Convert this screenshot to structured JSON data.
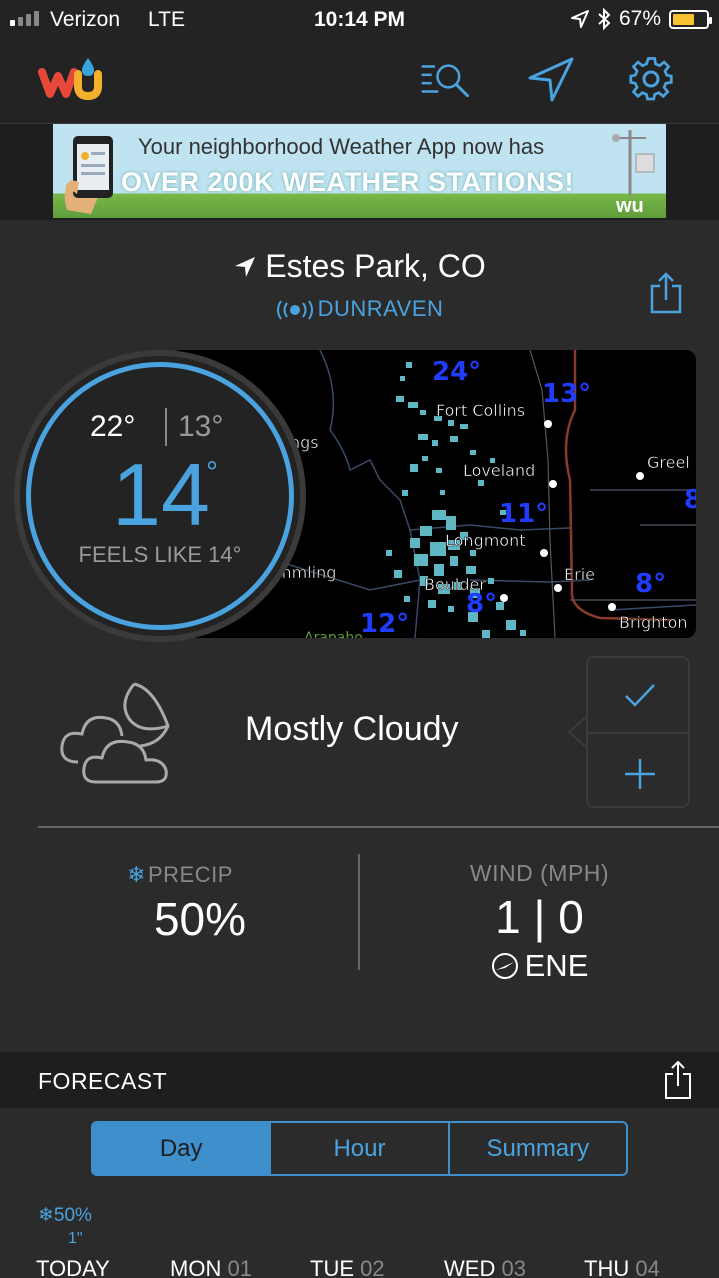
{
  "status_bar": {
    "carrier": "Verizon",
    "network": "LTE",
    "time": "10:14 PM",
    "battery": "67%",
    "battery_level": 0.67
  },
  "ad": {
    "line1": "Your neighborhood Weather App now has",
    "line2": "OVER 200K WEATHER STATIONS!",
    "logo_text": "wu"
  },
  "location": {
    "name": "Estes Park, CO",
    "station": "DUNRAVEN"
  },
  "map": {
    "labels": [
      {
        "text": "Fort Collins",
        "kind": "city"
      },
      {
        "text": "Loveland",
        "kind": "city"
      },
      {
        "text": "Greel",
        "kind": "city"
      },
      {
        "text": "Longmont",
        "kind": "city"
      },
      {
        "text": "Erie",
        "kind": "city"
      },
      {
        "text": "Boulder",
        "kind": "city"
      },
      {
        "text": "Brighton",
        "kind": "city"
      },
      {
        "text": "ngs",
        "kind": "city"
      },
      {
        "text": "mmling",
        "kind": "city"
      },
      {
        "text": "Arapaho",
        "kind": "area"
      }
    ],
    "temps": [
      "24°",
      "13°",
      "11°",
      "8°",
      "8°",
      "12°",
      "8"
    ]
  },
  "temperature": {
    "high": "22°",
    "low": "13°",
    "current": "14",
    "degree": "°",
    "feels_like": "FEELS LIKE 14°"
  },
  "condition": {
    "text": "Mostly Cloudy",
    "icon": "partly-cloudy-night-icon"
  },
  "precip": {
    "label": "PRECIP",
    "icon": "snowflake-icon",
    "value": "50%"
  },
  "wind": {
    "label": "WIND (MPH)",
    "value": "1 | 0",
    "direction": "ENE"
  },
  "forecast": {
    "title": "FORECAST",
    "tabs": [
      "Day",
      "Hour",
      "Summary"
    ],
    "active_tab": "Day",
    "today_precip": "50%",
    "today_accum": "1\"",
    "days": [
      {
        "name": "TODAY",
        "num": ""
      },
      {
        "name": "MON",
        "num": "01"
      },
      {
        "name": "TUE",
        "num": "02"
      },
      {
        "name": "WED",
        "num": "03"
      },
      {
        "name": "THU",
        "num": "04"
      }
    ]
  },
  "colors": {
    "accent": "#4aa3df",
    "map_temp": "#1f3cff",
    "radar": "#5fb7c4",
    "battery": "#f7c331"
  }
}
